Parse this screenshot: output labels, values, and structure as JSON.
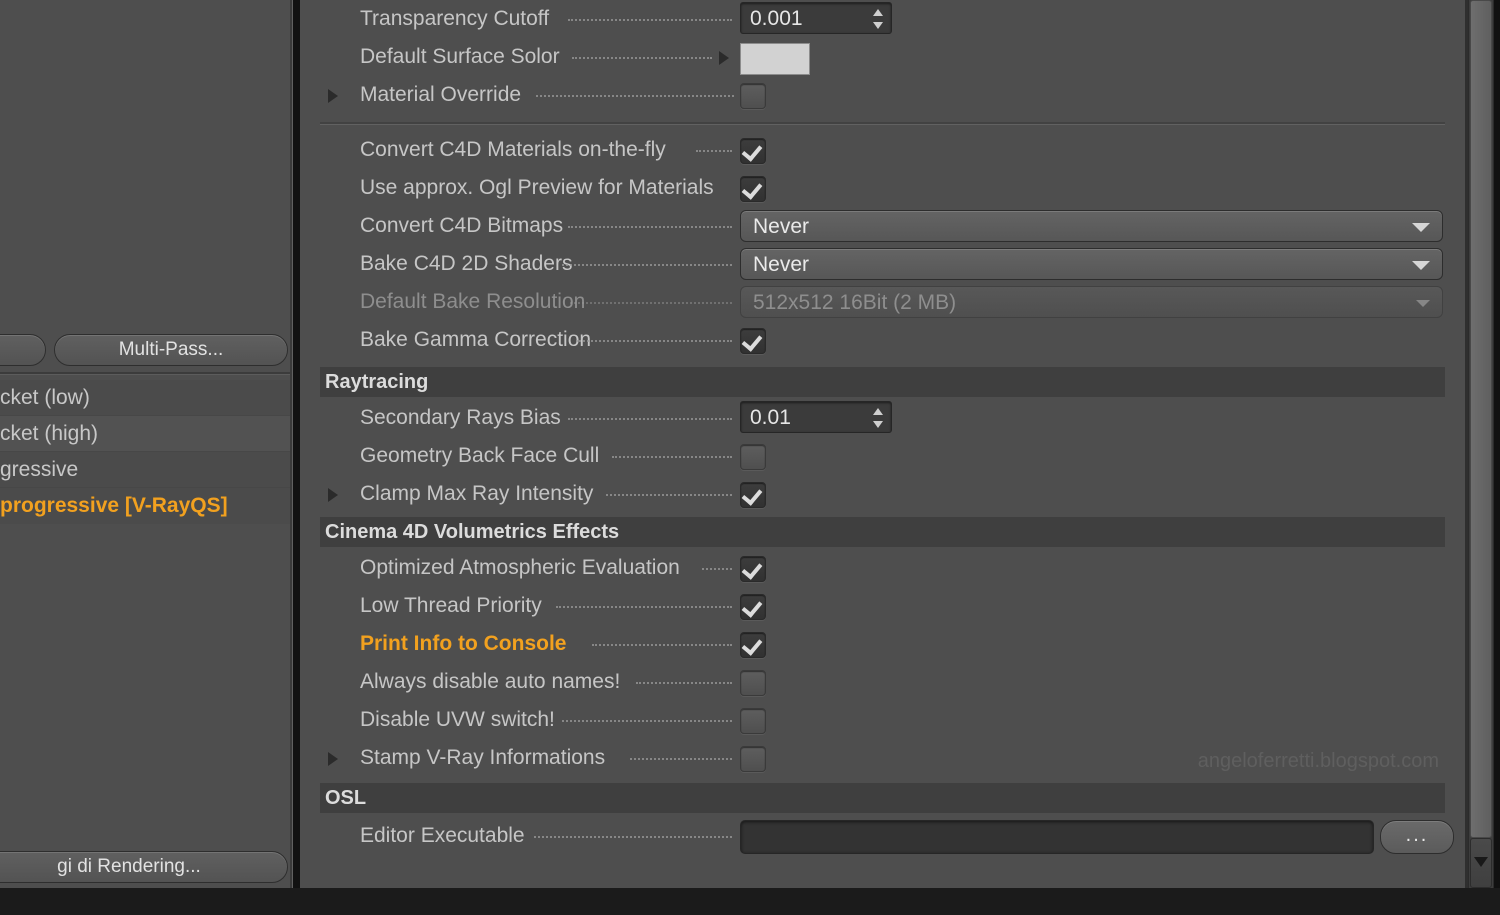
{
  "app": {
    "watermark": "angeloferretti.blogspot.com",
    "accent_color": "#f2a11f",
    "panel_bg": "#4e4e4e",
    "section_bg": "#3f3f3f"
  },
  "left_panel": {
    "buttons": {
      "partial_left_label": "",
      "multi_pass_label": "Multi-Pass...",
      "bottom_label": "gi di Rendering..."
    },
    "list_items": [
      {
        "label": "cket (low)",
        "selected": false
      },
      {
        "label": "cket (high)",
        "selected": false
      },
      {
        "label": "gressive",
        "selected": false
      },
      {
        "label": "progressive [V-RayQS]",
        "selected": true
      }
    ]
  },
  "main_panel": {
    "top_rows": [
      {
        "name": "transparency-cutoff",
        "label": "Transparency Cutoff",
        "widget": "number",
        "value": "0.001"
      },
      {
        "name": "default-surface-solor",
        "label": "Default Surface Solor",
        "widget": "color",
        "value": "#d2d2d2",
        "has_arrow": true
      },
      {
        "name": "material-override",
        "label": "Material Override",
        "widget": "checkbox",
        "checked": false,
        "expandable": true
      }
    ],
    "material_rows": [
      {
        "name": "convert-c4d-materials-on-the-fly",
        "label": "Convert C4D Materials on-the-fly",
        "widget": "checkbox",
        "checked": true
      },
      {
        "name": "use-approx-ogl-preview-for-materials",
        "label": "Use approx. Ogl Preview for Materials",
        "widget": "checkbox",
        "checked": true
      },
      {
        "name": "convert-c4d-bitmaps",
        "label": "Convert C4D Bitmaps",
        "widget": "dropdown",
        "value": "Never",
        "disabled": false
      },
      {
        "name": "bake-c4d-2d-shaders",
        "label": "Bake C4D 2D Shaders",
        "widget": "dropdown",
        "value": "Never",
        "disabled": false
      },
      {
        "name": "default-bake-resolution",
        "label": "Default Bake Resolution",
        "widget": "dropdown",
        "value": "512x512   16Bit   (2 MB)",
        "disabled": true
      },
      {
        "name": "bake-gamma-correction",
        "label": "Bake Gamma Correction",
        "widget": "checkbox",
        "checked": true
      }
    ],
    "sections": [
      {
        "name": "raytracing",
        "title": "Raytracing",
        "rows": [
          {
            "name": "secondary-rays-bias",
            "label": "Secondary Rays Bias",
            "widget": "number",
            "value": "0.01"
          },
          {
            "name": "geometry-back-face-cull",
            "label": "Geometry Back Face Cull",
            "widget": "checkbox",
            "checked": false
          },
          {
            "name": "clamp-max-ray-intensity",
            "label": "Clamp Max Ray Intensity",
            "widget": "checkbox",
            "checked": true,
            "expandable": true
          }
        ]
      },
      {
        "name": "cinema-4d-volumetrics-effects",
        "title": "Cinema 4D Volumetrics Effects",
        "rows": [
          {
            "name": "optimized-atmospheric-evaluation",
            "label": "Optimized Atmospheric Evaluation",
            "widget": "checkbox",
            "checked": true
          },
          {
            "name": "low-thread-priority",
            "label": "Low Thread Priority",
            "widget": "checkbox",
            "checked": true
          },
          {
            "name": "print-info-to-console",
            "label": "Print Info to Console",
            "widget": "checkbox",
            "checked": true,
            "highlighted": true
          },
          {
            "name": "always-disable-auto-names",
            "label": "Always disable auto names!",
            "widget": "checkbox",
            "checked": false
          },
          {
            "name": "disable-uvw-switch",
            "label": "Disable UVW switch!",
            "widget": "checkbox",
            "checked": false
          },
          {
            "name": "stamp-v-ray-informations",
            "label": "Stamp V-Ray Informations",
            "widget": "checkbox",
            "checked": false,
            "expandable": true
          }
        ]
      },
      {
        "name": "osl",
        "title": "OSL",
        "rows": [
          {
            "name": "editor-executable",
            "label": "Editor Executable",
            "widget": "textfield",
            "value": "",
            "browse_label": "..."
          }
        ]
      }
    ]
  }
}
